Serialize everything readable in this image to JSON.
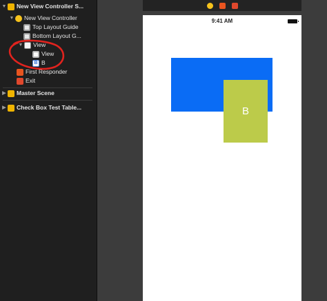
{
  "outline": {
    "scene_new_vc": "New View Controller S...",
    "new_view_controller": "New View Controller",
    "top_layout_guide": "Top Layout Guide",
    "bottom_layout_guide": "Bottom Layout G...",
    "view": "View",
    "subview": "View",
    "label_b": "B",
    "first_responder": "First Responder",
    "exit": "Exit",
    "master_scene": "Master Scene",
    "check_box_scene": "Check Box Test Table...",
    "b_badge": "B"
  },
  "canvas": {
    "status_time": "9:41 AM",
    "label_b_text": "B"
  },
  "colors": {
    "blue_view": "#0a6cf5",
    "green_view": "#bccb4a",
    "annotation": "#e0231e"
  },
  "icons": {
    "scene": "storyboard-scene-icon",
    "view_controller": "view-controller-icon",
    "layout_guide": "layout-guide-icon",
    "view": "view-icon",
    "label": "label-icon",
    "first_responder": "first-responder-icon",
    "exit": "exit-icon"
  }
}
